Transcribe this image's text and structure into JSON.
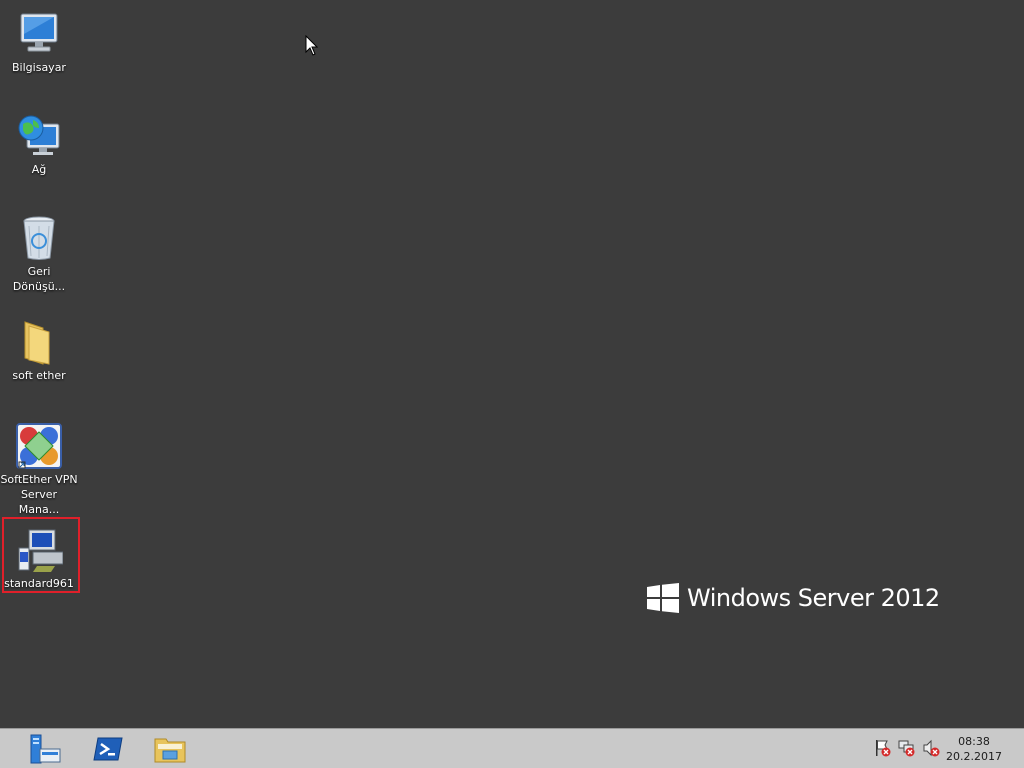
{
  "desktop": {
    "icons": [
      {
        "label": "Bilgisayar",
        "icon": "computer-icon"
      },
      {
        "label": "Ağ",
        "icon": "network-icon"
      },
      {
        "label": "Geri\nDönüşü...",
        "icon": "recycle-bin-icon"
      },
      {
        "label": "soft ether",
        "icon": "folder-icon"
      },
      {
        "label": "SoftEther VPN\nServer Mana...",
        "icon": "softether-vpn-icon"
      },
      {
        "label": "standard961",
        "icon": "installer-icon",
        "selected": true
      }
    ],
    "brand": "Windows Server 2012"
  },
  "taskbar": {
    "pinned": [
      {
        "name": "server-manager",
        "icon": "server-manager-icon"
      },
      {
        "name": "powershell",
        "icon": "powershell-icon"
      },
      {
        "name": "file-explorer",
        "icon": "file-explorer-icon"
      }
    ],
    "tray": [
      {
        "icon": "action-center-flag-icon"
      },
      {
        "icon": "network-error-icon"
      },
      {
        "icon": "volume-muted-icon"
      }
    ],
    "clock": {
      "time": "08:38",
      "date": "20.2.2017"
    }
  },
  "colors": {
    "desktop": "#3c3c3c",
    "taskbar": "#c9c9c9",
    "selection": "#e0202a"
  }
}
